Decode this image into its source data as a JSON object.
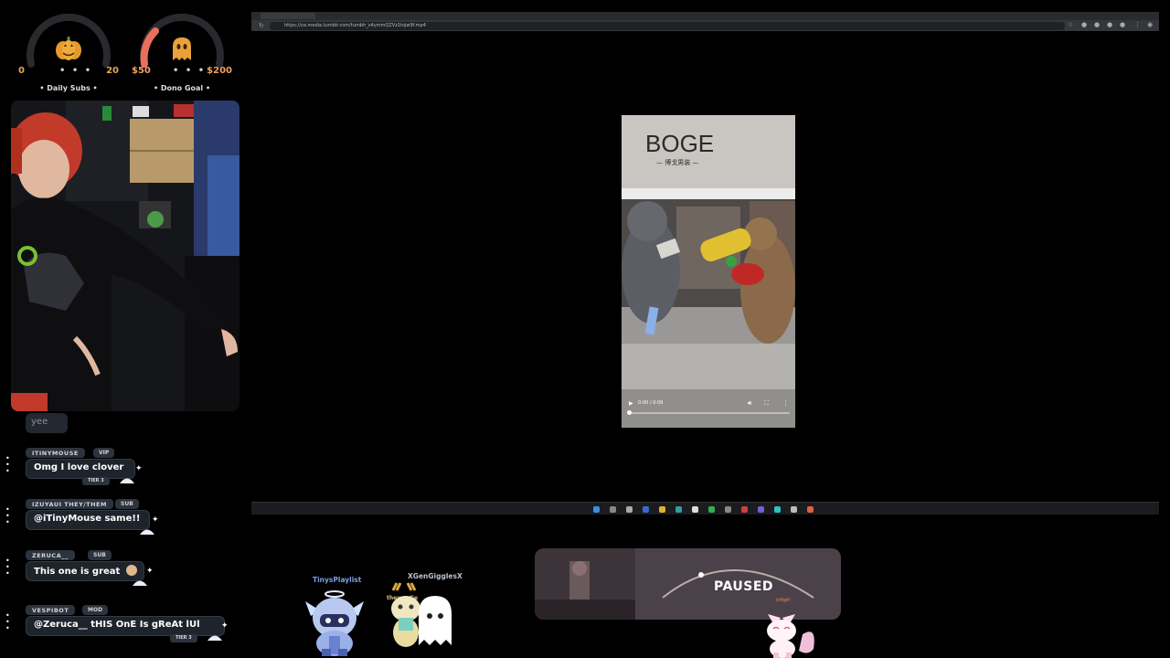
{
  "gauges": {
    "subs": {
      "min": "0",
      "dots": "• • •",
      "max": "20",
      "label": "• Daily Subs •"
    },
    "dono": {
      "min": "$50",
      "dots": "• • •",
      "max": "$200",
      "label": "• Dono Goal •"
    }
  },
  "chat": {
    "old_message": "yee",
    "messages": [
      {
        "name": "ITINYMOUSE",
        "role": "VIP",
        "text": "Omg I love clover",
        "tier": "TIER 3"
      },
      {
        "name": "IZUYAUI THEY/THEM",
        "role": "SUB",
        "text": "@iTinyMouse same!!"
      },
      {
        "name": "ZERUCA__",
        "role": "SUB",
        "text": "This one is great"
      },
      {
        "name": "VESPIBOT",
        "role": "MOD",
        "text": "@Zeruca__ tHIS OnE Is gReAt lUl",
        "tier": "TIER 3"
      }
    ]
  },
  "browser": {
    "url": "https://va.media.tumblr.com/tumblr_s4ymmQZVz1tojw9f.mp4"
  },
  "video": {
    "sign_text": "BOGE",
    "sign_subtext": "— 博戈男装 —",
    "time": "0:00 / 0:09",
    "progress": 0
  },
  "mascots": {
    "left_label": "TinysPlaylist",
    "right_label": "XGenGigglesX",
    "small_label": "thewpaGe"
  },
  "music": {
    "status": "PAUSED",
    "tag": "lofigirl"
  },
  "colors": {
    "gauge_track": "#2a2a2e",
    "gauge_orange": "#e8705a",
    "chat_bubble": "#1e242c",
    "badge": "#2c333d"
  }
}
